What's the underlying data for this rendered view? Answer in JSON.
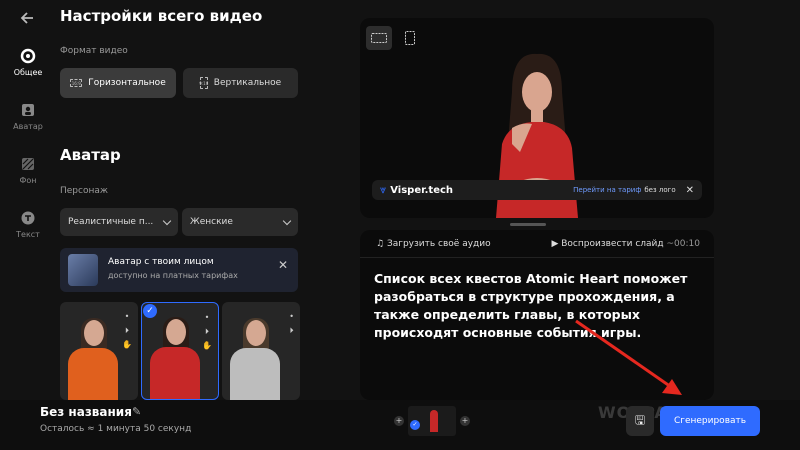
{
  "sidebar": {
    "items": [
      {
        "label": "Общее",
        "icon": "target-icon",
        "active": true
      },
      {
        "label": "Аватар",
        "icon": "person-icon",
        "active": false
      },
      {
        "label": "Фон",
        "icon": "pattern-icon",
        "active": false
      },
      {
        "label": "Текст",
        "icon": "text-icon",
        "active": false
      }
    ]
  },
  "settings": {
    "title": "Настройки всего видео",
    "format_label": "Формат видео",
    "horizontal": "Горизонтальное",
    "vertical": "Вертикальное",
    "ratio_h": "16:9",
    "ratio_v": "9:16"
  },
  "avatar": {
    "title": "Аватар",
    "character_label": "Персонаж",
    "type_select": "Реалистичные п...",
    "gender_select": "Женские",
    "promo_title": "Аватар с твоим лицом",
    "promo_subtitle": "доступно на платных тарифах"
  },
  "preview": {
    "ratio_h": "16:9",
    "ratio_v": "9:16",
    "logo": "Visper.tech",
    "link": "Перейти на тариф",
    "link_rest": "без лого"
  },
  "script": {
    "upload": "Загрузить своё аудио",
    "play": "Воспроизвести слайд",
    "time": "~00:10",
    "text": "Список всех квестов Atomic Heart поможет разобраться в структуре прохождения, а также определить главы, в которых происходят основные события игры."
  },
  "bottom": {
    "project_name": "Без названия",
    "remaining": "Осталось ≈ 1 минута 50 секунд",
    "generate": "Сгенерировать",
    "watermark": "WOTPACK.RU"
  },
  "colors": {
    "accent": "#2f6bff",
    "background": "#121212"
  }
}
